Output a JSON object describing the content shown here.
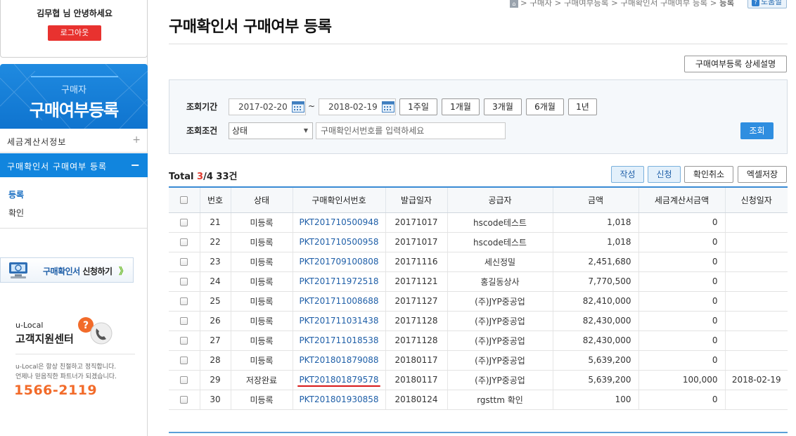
{
  "sidebar": {
    "greeting": "김무협 님 안녕하세요",
    "logout_label": "로그아웃",
    "banner_subtitle": "구매자",
    "banner_title": "구매여부등록",
    "menu": [
      {
        "label": "세금계산서정보",
        "toggle": "+"
      },
      {
        "label": "구매확인서 구매여부 등록",
        "toggle": "−"
      }
    ],
    "submenu": [
      {
        "label": "등록"
      },
      {
        "label": "확인"
      }
    ],
    "apply_banner": {
      "text_blue": "구매확인서",
      "text_dark": " 신청하기",
      "arrow": "》"
    },
    "support": {
      "label": "u-Local",
      "title": "고객지원센터",
      "desc_line1": "u-Local은 항상 친절하고 정직합니다.",
      "desc_line2": "언제나 믿음직한 파트너가 되겠습니다.",
      "phone": "1566-2119"
    }
  },
  "breadcrumb": {
    "home_icon": "home-icon",
    "text": "> 구매자 > 구매여부등록 > 구매확인서 구매여부 등록 > ",
    "current": "등록"
  },
  "help_label": "도움말",
  "page_title": "구매확인서 구매여부 등록",
  "detail_button": "구매여부등록 상세설명",
  "search": {
    "period_label": "조회기간",
    "date_from": "2017-02-20",
    "date_to": "2018-02-19",
    "tilde": "~",
    "periods": [
      "1주일",
      "1개월",
      "3개월",
      "6개월",
      "1년"
    ],
    "condition_label": "조회조건",
    "condition_select": "상태",
    "placeholder": "구매확인서번호를 입력하세요",
    "button": "조회"
  },
  "total": {
    "prefix": "Total ",
    "current": "3",
    "rest": "/4 33건"
  },
  "actions": {
    "write": "작성",
    "apply": "신청",
    "cancel": "확인취소",
    "excel": "엑셀저장"
  },
  "table": {
    "headers": [
      "번호",
      "상태",
      "구매확인서번호",
      "발급일자",
      "공급자",
      "금액",
      "세금계산서금액",
      "신청일자"
    ],
    "rows": [
      {
        "no": "21",
        "status": "미등록",
        "doc": "PKT201710500948",
        "date": "20171017",
        "supplier": "hscode테스트",
        "amount": "1,018",
        "tax": "0",
        "apply_date": ""
      },
      {
        "no": "22",
        "status": "미등록",
        "doc": "PKT201710500958",
        "date": "20171017",
        "supplier": "hscode테스트",
        "amount": "1,018",
        "tax": "0",
        "apply_date": ""
      },
      {
        "no": "23",
        "status": "미등록",
        "doc": "PKT201709100808",
        "date": "20171116",
        "supplier": "세신정밀",
        "amount": "2,451,680",
        "tax": "0",
        "apply_date": ""
      },
      {
        "no": "24",
        "status": "미등록",
        "doc": "PKT201711972518",
        "date": "20171121",
        "supplier": "홍길동상사",
        "amount": "7,770,500",
        "tax": "0",
        "apply_date": ""
      },
      {
        "no": "25",
        "status": "미등록",
        "doc": "PKT201711008688",
        "date": "20171127",
        "supplier": "(주)JYP중공업",
        "amount": "82,410,000",
        "tax": "0",
        "apply_date": ""
      },
      {
        "no": "26",
        "status": "미등록",
        "doc": "PKT201711031438",
        "date": "20171128",
        "supplier": "(주)JYP중공업",
        "amount": "82,430,000",
        "tax": "0",
        "apply_date": ""
      },
      {
        "no": "27",
        "status": "미등록",
        "doc": "PKT201711018538",
        "date": "20171128",
        "supplier": "(주)JYP중공업",
        "amount": "82,430,000",
        "tax": "0",
        "apply_date": ""
      },
      {
        "no": "28",
        "status": "미등록",
        "doc": "PKT201801879088",
        "date": "20180117",
        "supplier": "(주)JYP중공업",
        "amount": "5,639,200",
        "tax": "0",
        "apply_date": ""
      },
      {
        "no": "29",
        "status": "저장완료",
        "doc": "PKT201801879578",
        "date": "20180117",
        "supplier": "(주)JYP중공업",
        "amount": "5,639,200",
        "tax": "100,000",
        "apply_date": "2018-02-19"
      },
      {
        "no": "30",
        "status": "미등록",
        "doc": "PKT201801930858",
        "date": "20180124",
        "supplier": "rgsttm 확인",
        "amount": "100",
        "tax": "0",
        "apply_date": ""
      }
    ]
  },
  "colors": {
    "accent": "#1185de",
    "link": "#1f5fa8",
    "logout": "#e8322f",
    "total_red": "#e03b2f",
    "phone": "#f26b2a",
    "highlight": "#d81818"
  }
}
